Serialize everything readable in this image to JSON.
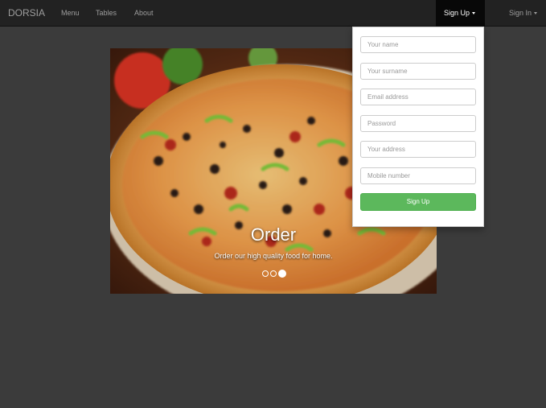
{
  "navbar": {
    "brand": "DORSIA",
    "links": [
      {
        "label": "Menu"
      },
      {
        "label": "Tables"
      },
      {
        "label": "About"
      }
    ],
    "signup_label": "Sign Up",
    "signin_label": "Sign In"
  },
  "carousel": {
    "title": "Order",
    "subtitle": "Order our high quality food for home.",
    "indicator_count": 3,
    "active_indicator": 3
  },
  "signup_form": {
    "fields": [
      {
        "placeholder": "Your name",
        "value": ""
      },
      {
        "placeholder": "Your surname",
        "value": ""
      },
      {
        "placeholder": "Email address",
        "value": ""
      },
      {
        "placeholder": "Password",
        "value": ""
      },
      {
        "placeholder": "Your address",
        "value": ""
      },
      {
        "placeholder": "Mobile number",
        "value": ""
      }
    ],
    "submit_label": "Sign Up"
  },
  "colors": {
    "navbar_bg": "#222222",
    "page_bg": "#3b3b3b",
    "submit_green": "#5cb85c"
  }
}
